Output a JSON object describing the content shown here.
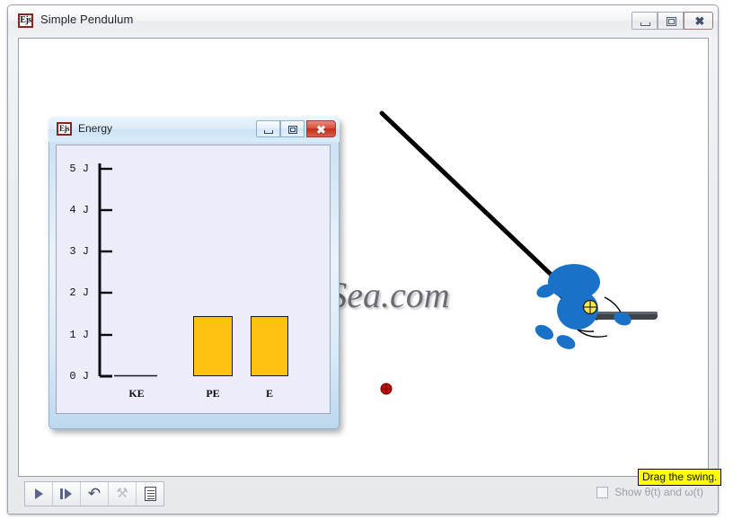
{
  "window": {
    "title": "Simple Pendulum",
    "icon_label": "Ejs",
    "icon_name": "ejs-icon",
    "controls": {
      "minimize": "─",
      "maximize": "□",
      "close": "✕"
    }
  },
  "watermark": {
    "text": "SoftSea.com"
  },
  "energy_dialog": {
    "title": "Energy",
    "icon_label": "Ejs",
    "controls": {
      "minimize": "─",
      "maximize": "□",
      "close": "✕"
    }
  },
  "chart_data": {
    "type": "bar",
    "title": "Energy",
    "categories": [
      "KE",
      "PE",
      "E"
    ],
    "values": [
      0.0,
      1.45,
      1.45
    ],
    "unit": "J",
    "ylabel": "",
    "xlabel": "",
    "ylim": [
      0,
      5.6
    ],
    "yticks": [
      0,
      1,
      2,
      3,
      4,
      5
    ],
    "ytick_labels": [
      "0 J",
      "1 J",
      "2 J",
      "3 J",
      "4 J",
      "5 J"
    ],
    "bar_color": "#ffc212",
    "bar_edge_color": "#1a1a24",
    "plot_background": "#ecedfa",
    "grid": false,
    "legend": false
  },
  "simulation": {
    "rope_color": "#000000",
    "figure_color": "#1a72c8",
    "board_color": "#3c4248",
    "pivot_marker_color": "#ffe84a",
    "handle_marker_color": "#c20c0c",
    "rope_start": [
      416,
      120
    ],
    "rope_end": [
      655,
      348
    ]
  },
  "toolbar": {
    "buttons": [
      {
        "name": "play-button",
        "icon": "play-icon",
        "label": "Play",
        "enabled": true
      },
      {
        "name": "step-button",
        "icon": "step-icon",
        "label": "Step",
        "enabled": true
      },
      {
        "name": "reset-button",
        "icon": "reset-icon",
        "glyph": "↶",
        "label": "Reset",
        "enabled": true
      },
      {
        "name": "tools-button",
        "icon": "wrench-icon",
        "glyph": "⚒",
        "label": "Tools",
        "enabled": false
      },
      {
        "name": "pages-button",
        "icon": "document-icon",
        "label": "Pages",
        "enabled": true
      }
    ]
  },
  "footer": {
    "checkbox_label": "Show θ(t) and ω(t)",
    "checkbox_checked": false
  },
  "tooltip": {
    "text": "Drag the swing."
  }
}
